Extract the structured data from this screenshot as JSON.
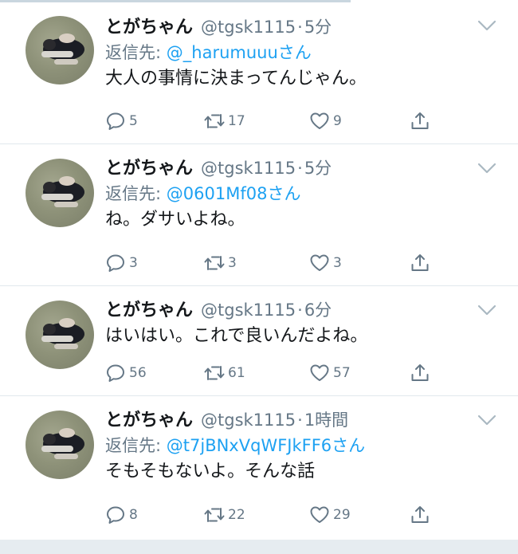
{
  "tweets": [
    {
      "display_name": "とがちゃん",
      "handle": "@tgsk1115",
      "separator": "·",
      "time": "5分",
      "reply_prefix": "返信先: ",
      "reply_target": "@_harumuuuさん",
      "text": "大人の事情に決まってんじゃん。",
      "replies": "5",
      "retweets": "17",
      "likes": "9"
    },
    {
      "display_name": "とがちゃん",
      "handle": "@tgsk1115",
      "separator": "·",
      "time": "5分",
      "reply_prefix": "返信先: ",
      "reply_target": "@0601Mf08さん",
      "text": "ね。ダサいよね。",
      "replies": "3",
      "retweets": "3",
      "likes": "3"
    },
    {
      "display_name": "とがちゃん",
      "handle": "@tgsk1115",
      "separator": "·",
      "time": "6分",
      "text": "はいはい。これで良いんだよね。",
      "replies": "56",
      "retweets": "61",
      "likes": "57"
    },
    {
      "display_name": "とがちゃん",
      "handle": "@tgsk1115",
      "separator": "·",
      "time": "1時間",
      "reply_prefix": "返信先: ",
      "reply_target": "@t7jBNxVqWFJkFF6さん",
      "text": "そもそもないよ。そんな話",
      "replies": "8",
      "retweets": "22",
      "likes": "29"
    }
  ],
  "icons": {
    "reply": "reply-icon",
    "retweet": "retweet-icon",
    "like": "heart-icon",
    "share": "share-icon",
    "menu": "chevron-down-icon"
  },
  "colors": {
    "link": "#1da1f2",
    "secondary_text": "#657786",
    "primary_text": "#14171a",
    "divider": "#e1e8ed"
  }
}
